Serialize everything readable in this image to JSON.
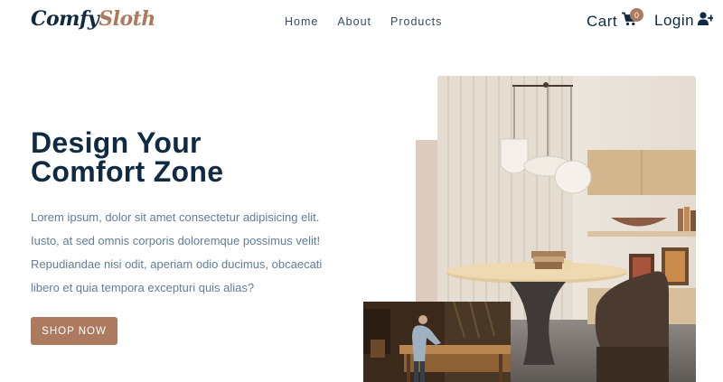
{
  "nav": {
    "logo_part1": "Comfy",
    "logo_part2": "Sloth",
    "links": [
      "Home",
      "About",
      "Products"
    ],
    "cart_label": "Cart",
    "cart_count": "0",
    "login_label": "Login"
  },
  "hero": {
    "title_line1": "Design Your",
    "title_line2": "Comfort Zone",
    "text_lines": [
      "Lorem ipsum, dolor sit amet consectetur adipisicing elit.",
      "Iusto, at sed omnis corporis doloremque possimus velit!",
      "Repudiandae nisi odit, aperiam odio ducimus, obcaecati",
      "libero et quia tempora excepturi quis alias?"
    ],
    "cta_label": "SHOP NOW"
  },
  "colors": {
    "primary": "#ab7a5f",
    "primary_light": "#decbc0",
    "heading": "#102a42",
    "body_text": "#617d98"
  },
  "icons": {
    "cart": "cart-icon",
    "login": "user-plus-icon"
  }
}
